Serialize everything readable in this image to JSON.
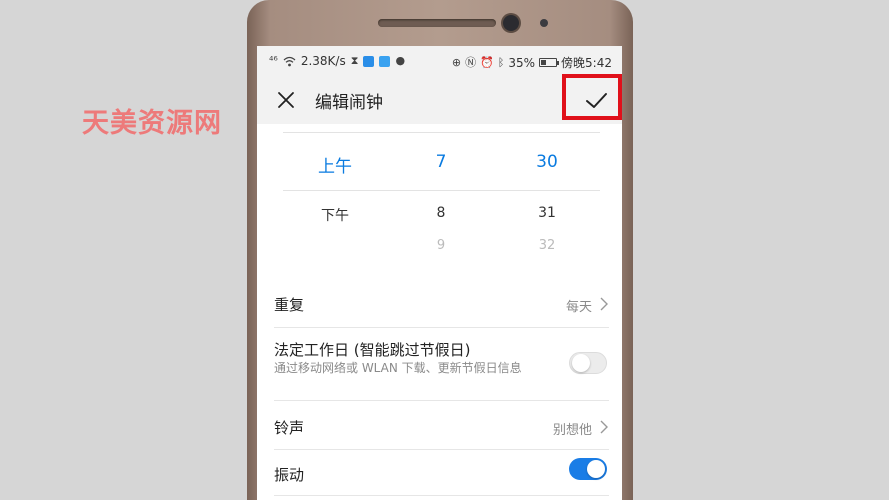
{
  "watermark": "天美资源网",
  "status_bar": {
    "signal": "⁴⁶",
    "net_speed": "2.38K/s",
    "battery_percent": "35%",
    "time": "傍晚5:42",
    "battery_level": 0.35
  },
  "header": {
    "title": "编辑闹钟",
    "close_icon": "close-icon",
    "confirm_icon": "check-icon"
  },
  "picker": {
    "period": {
      "selected": "上午",
      "next": "下午"
    },
    "hour": {
      "selected": "7",
      "next": "8",
      "faded": "9"
    },
    "minute": {
      "selected": "30",
      "next": "31",
      "faded": "32"
    }
  },
  "settings": {
    "repeat": {
      "label": "重复",
      "value": "每天"
    },
    "workday": {
      "label": "法定工作日 (智能跳过节假日)",
      "sublabel": "通过移动网络或 WLAN 下载、更新节假日信息",
      "enabled": false
    },
    "ringtone": {
      "label": "铃声",
      "value": "别想他"
    },
    "vibrate": {
      "label": "振动",
      "enabled": true
    }
  },
  "colors": {
    "accent": "#0a7be0",
    "toggle_on": "#1a7de6",
    "highlight": "#e0101a",
    "watermark": "#f26b6b"
  }
}
